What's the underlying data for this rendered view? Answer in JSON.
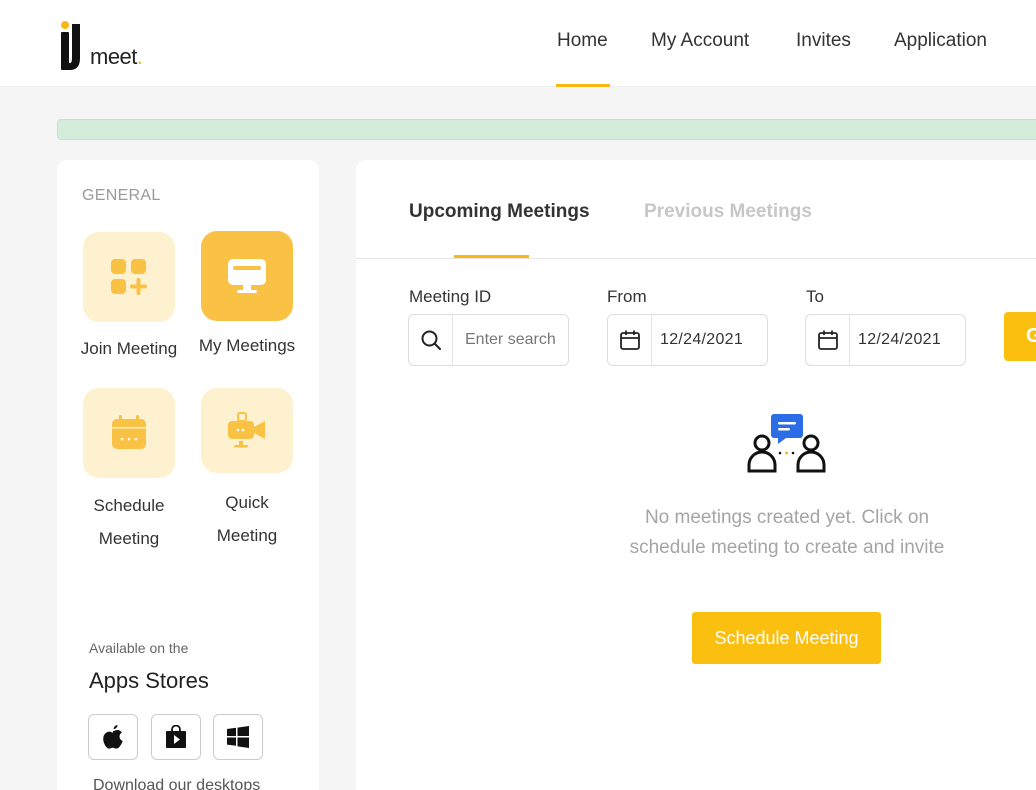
{
  "brand": {
    "logo_mark": "IJ",
    "logo_word": "meet",
    "accent": "#f9b815"
  },
  "nav": [
    {
      "label": "Home",
      "active": true
    },
    {
      "label": "My Account"
    },
    {
      "label": "Invites"
    },
    {
      "label": "Application"
    }
  ],
  "sidebar": {
    "section_label": "GENERAL",
    "tiles": [
      {
        "label": "Join Meeting",
        "icon": "grid-plus-icon"
      },
      {
        "label": "My Meetings",
        "icon": "monitor-icon",
        "active": true
      },
      {
        "label_line1": "Schedule",
        "label_line2": "Meeting",
        "icon": "calendar-icon"
      },
      {
        "label_line1": "Quick",
        "label_line2": "Meeting",
        "icon": "video-camera-icon"
      }
    ],
    "available": "Available on the",
    "stores_title": "Apps Stores",
    "store_icons": [
      "apple-icon",
      "play-store-icon",
      "windows-icon"
    ],
    "download_text": "Download our desktops"
  },
  "main": {
    "tabs": [
      {
        "label": "Upcoming Meetings",
        "active": true
      },
      {
        "label": "Previous Meetings"
      }
    ],
    "filters": {
      "meeting_id_label": "Meeting ID",
      "search_placeholder": "Enter search",
      "from_label": "From",
      "from_value": "12/24/2021",
      "to_label": "To",
      "to_value": "12/24/2021",
      "go_label": "G"
    },
    "empty_state": {
      "icon": "people-chat-icon",
      "message": "No meetings created yet. Click on schedule meeting to create and invite",
      "button": "Schedule Meeting"
    }
  }
}
